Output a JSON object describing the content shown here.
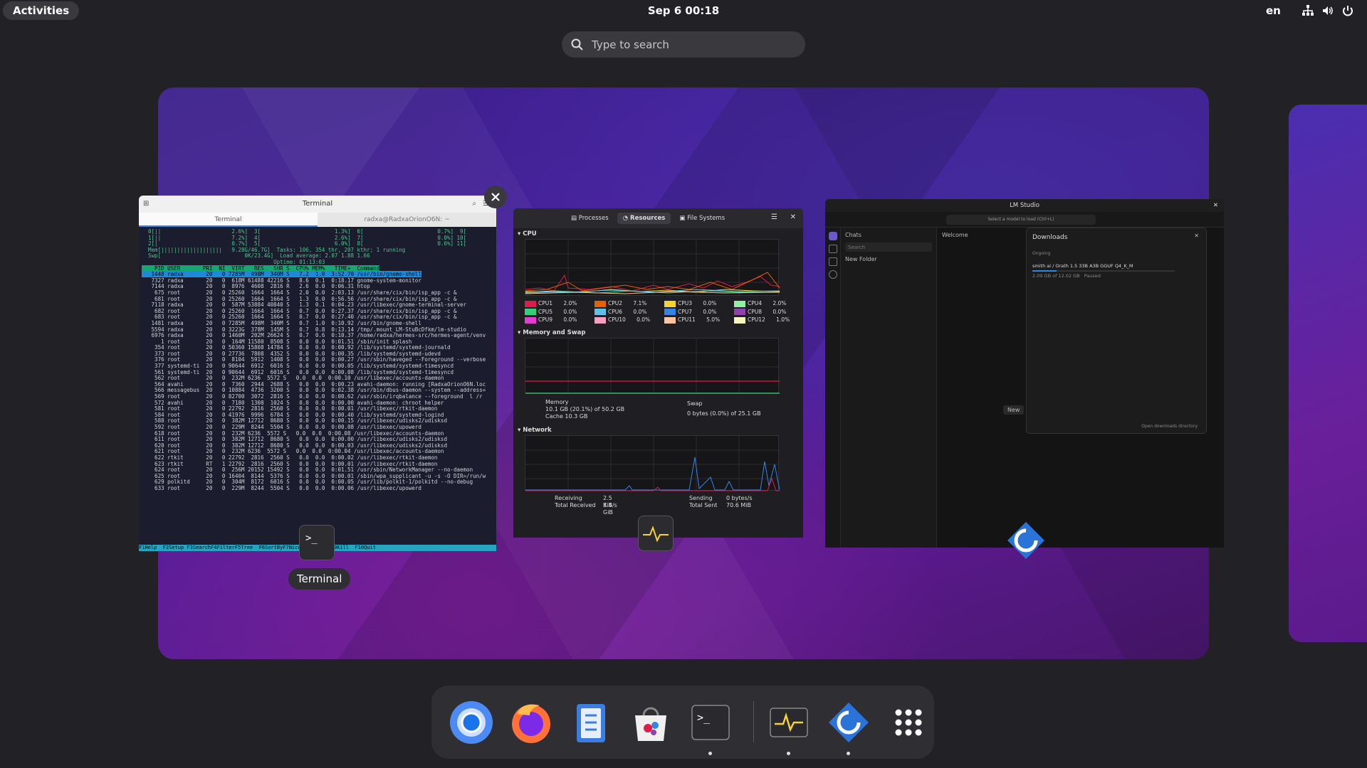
{
  "topbar": {
    "activities_label": "Activities",
    "clock": "Sep 6  00:18",
    "keyboard_layout": "en"
  },
  "search": {
    "placeholder": "Type to search"
  },
  "terminal_window": {
    "title": "Terminal",
    "tab_active": "Terminal",
    "tab_other": "radxa@RadxaOrionO6N: ~",
    "label": "Terminal",
    "htop_header": "  0[||                      2.6%]  3[                       1.3%]  6[                       0.7%]  9[                       0.7%]\n  1[||                      7.2%]  4[                       2.6%]  7[                       0.0%] 10[                       0.5%]\n  2[|                       0.7%]  5[                       6.0%]  8[                       0.6%] 11[                       2.6%]\n  Mem[|||||||||||||||||||   9.28G/46.7G]  Tasks: 106, 354 thr, 207 kthr; 1 running\n  Swp[                          0K/23.4G]  Load average: 2.07 1.88 1.66\n                                         Uptime: 01:13:03",
    "htop_columns": "    PID USER       PRI  NI  VIRT   RES   SHR S  CPU% MEM%   TIME+  Command",
    "htop_selected": "   1448 radxa       20   0 7285M  498M  340M S   7.2  1.0  3:52.70 /usr/bin/gnome-shell",
    "htop_rows": "   7327 radxa       20   0  618M 61488 42216 S   8.6  0.1  0:18.17 gnome-system-monitor\n   7144 radxa       20   0  8976  4608  2816 R   2.6  0.0  0:06.31 htop\n    675 root        20   0 25260  1664  1664 S   2.0  0.0  2:03.13 /usr/share/cix/bin/isp_app -c &\n    681 root        20   0 25260  1664  1664 S   1.3  0.0  0:56.56 /usr/share/cix/bin/isp_app -c &\n   7118 radxa       20   0  587M 53884 40840 S   1.3  0.1  0:04.23 /usr/libexec/gnome-terminal-server\n    682 root        20   0 25260  1664  1664 S   0.7  0.0  0:27.37 /usr/share/cix/bin/isp_app -c &\n    683 root        20   0 25260  1664  1664 S   0.7  0.0  0:27.40 /usr/share/cix/bin/isp_app -c &\n   1481 radxa       20   0 7285M  498M  340M S   0.7  1.0  0:10.92 /usr/bin/gnome-shell\n   5594 radxa       20   0 3223G  378M  145M S   0.7  0.8  0:13.14 /tmp/.mount_LM-StuBcDfkm/lm-studio\n   6976 radxa       20   0 1460M  202M 26624 S   0.7  0.6  0:10.37 /home/radxa/hermes-src/hermes-agent/venv\n      1 root        20   0  164M 11580  8508 S   0.0  0.0  0:01.51 /sbin/init splash\n    354 root        20   0 50360 15808 14784 S   0.0  0.0  0:00.92 /lib/systemd/systemd-journald\n    373 root        20   0 27736  7808  4352 S   0.0  0.0  0:00.35 /lib/systemd/systemd-udevd\n    376 root        20   0  8104  5912  1408 S   0.0  0.0  0:00.27 /usr/sbin/haveged --Foreground --verbose\n    377 systemd-ti  20   0 90644  6912  6016 S   0.0  0.0  0:00.05 /lib/systemd/systemd-timesyncd\n    561 systemd-ti  20   0 90644  6912  6016 S   0.0  0.0  0:00.08 /lib/systemd/systemd-timesyncd\n    562 root        20   0  232M 6236  5572 S   0.0  0.0  0:00.10 /usr/libexec/accounts-daemon\n    564 avahi       20   0  7360  2944  2688 S   0.0  0.0  0:00.23 avahi-daemon: running [RadxaOrionO6N.loc\n    566 messagebus  20   0 10884  4736  3200 S   0.0  0.0  0:02.38 /usr/bin/dbus-daemon --system --address=\n    569 root        20   0 82700  3072  2816 S   0.0  0.0  0:00.62 /usr/sbin/irqbalance --foreground  l /r\n    572 avahi       20   0  7180  1308  1024 S   0.0  0.0  0:00.00 avahi-daemon: chroot helper\n    581 root        20   0 22792  2816  2560 S   0.0  0.0  0:00.01 /usr/libexec/rtkit-daemon\n    584 root        20   0 41976  9996  6784 S   0.0  0.0  0:00.40 /lib/systemd/systemd-logind\n    588 root        20   0  382M 12712  8680 S   0.0  0.0  0:00.15 /usr/libexec/udisks2/udisksd\n    592 root        20   0  229M  8244  5504 S   0.0  0.0  0:00.08 /usr/libexec/upowerd\n    618 root        20   0  232M 6236  5572 S   0.0  0.0  0:00.08 /usr/libexec/accounts-daemon\n    611 root        20   0  382M 12712  8680 S   0.0  0.0  0:00.00 /usr/libexec/udisks2/udisksd\n    620 root        20   0  382M 12712  8680 S   0.0  0.0  0:00.03 /usr/libexec/udisks2/udisksd\n    621 root        20   0  232M 6236  5572 S   0.0  0.0  0:00.04 /usr/libexec/accounts-daemon\n    622 rtkit       20   0 22792  2816  2560 S   0.0  0.0  0:00.02 /usr/libexec/rtkit-daemon\n    623 rtkit       RT   1 22792  2816  2560 S   0.0  0.0  0:00.01 /usr/libexec/rtkit-daemon\n    624 root        20   0  256M 20152 15492 S   0.0  0.0  0:01.51 /usr/sbin/NetworkManager --no-daemon\n    625 root        20   0 16404  8144  5376 S   0.0  0.0  0:00.01 /sbin/wpa_supplicant -u -s -O DIR=/run/w\n    629 polkitd     20   0  304M  8172  6016 S   0.0  0.0  0:00.05 /usr/lib/polkit-1/polkitd --no-debug\n    633 root        20   0  229M  8244  5504 S   0.0  0.0  0:00.06 /usr/libexec/upowerd",
    "htop_fkeys": "F1Help  F2Setup F3SearchF4FilterF5Tree  F6SortByF7Nice -F8Nice +F9Kill  F10Quit"
  },
  "system_monitor": {
    "tabs": [
      "Processes",
      "Resources",
      "File Systems"
    ],
    "cpu_section": "CPU",
    "cpus": [
      {
        "name": "CPU1",
        "pct": "2.0%",
        "color": "#e01b4b"
      },
      {
        "name": "CPU2",
        "pct": "7.1%",
        "color": "#e66100"
      },
      {
        "name": "CPU3",
        "pct": "0.0%",
        "color": "#f6d32d"
      },
      {
        "name": "CPU4",
        "pct": "2.0%",
        "color": "#8ff0a4"
      },
      {
        "name": "CPU5",
        "pct": "0.0%",
        "color": "#33d17a"
      },
      {
        "name": "CPU6",
        "pct": "0.0%",
        "color": "#62c0e6"
      },
      {
        "name": "CPU7",
        "pct": "0.0%",
        "color": "#3584e4"
      },
      {
        "name": "CPU8",
        "pct": "0.0%",
        "color": "#9141ac"
      },
      {
        "name": "CPU9",
        "pct": "0.0%",
        "color": "#e040d0"
      },
      {
        "name": "CPU10",
        "pct": "0.0%",
        "color": "#f5a0c0"
      },
      {
        "name": "CPU11",
        "pct": "5.0%",
        "color": "#f9c6a0"
      },
      {
        "name": "CPU12",
        "pct": "1.0%",
        "color": "#f6f5c0"
      }
    ],
    "mem_section": "Memory and Swap",
    "memory_label": "Memory",
    "memory_used": "10.1 GB (20.1%) of 50.2 GB",
    "memory_cache": "Cache 10.3 GB",
    "swap_label": "Swap",
    "swap_used": "0 bytes (0.0%) of 25.1 GB",
    "net_section": "Network",
    "receiving_label": "Receiving",
    "receiving_value": "2.5 KiB/s",
    "total_received_label": "Total Received",
    "total_received_value": "3.4 GiB",
    "sending_label": "Sending",
    "sending_value": "0 bytes/s",
    "total_sent_label": "Total Sent",
    "total_sent_value": "70.6 MiB"
  },
  "lm_studio": {
    "title": "LM Studio",
    "model_select": "Select a model to load (Ctrl+L)",
    "chats_label": "Chats",
    "search_placeholder": "Search",
    "new_folder": "New Folder",
    "welcome": "Welcome",
    "downloads_title": "Downloads",
    "ongoing": "Ongoing",
    "download_name": "smith ai / Orath 1.5 33B A3B GGUF Q4_K_M",
    "download_progress": "2.09 GB of 12.02 GB",
    "download_status": "Paused",
    "open_dir": "Open downloads directory",
    "new_btn": "New"
  },
  "dock": {
    "apps": [
      "chromium",
      "firefox",
      "files",
      "software",
      "terminal",
      "system-monitor",
      "lm-studio",
      "app-grid"
    ]
  }
}
